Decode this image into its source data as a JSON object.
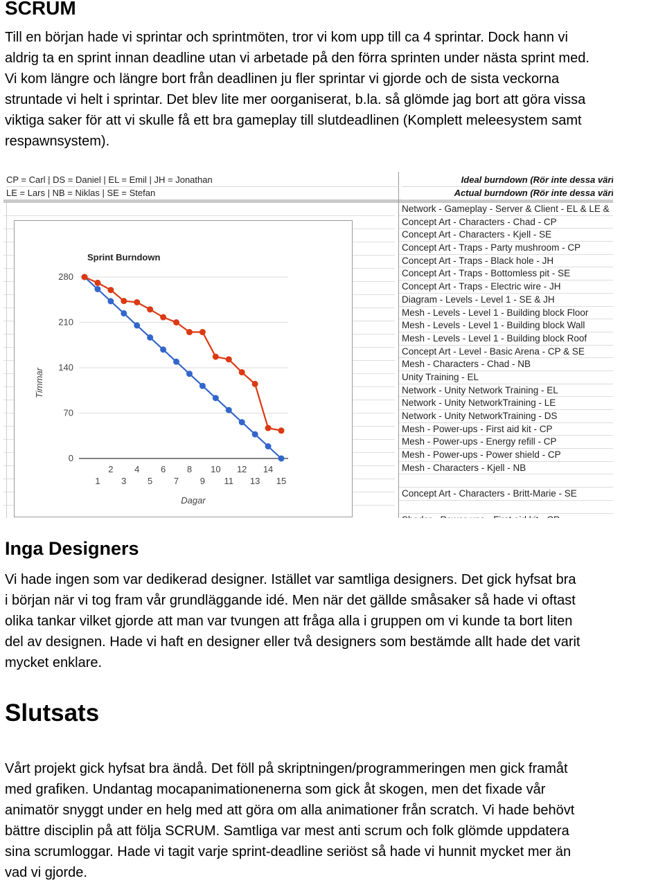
{
  "sections": {
    "scrum": {
      "heading": "SCRUM",
      "lines": [
        "Till en början hade vi sprintar och sprintmöten, tror vi kom upp till ca 4 sprintar. Dock hann vi",
        "aldrig ta en sprint innan deadline utan vi arbetade på den förra sprinten under nästa sprint med.",
        "Vi kom längre och längre bort från deadlinen ju fler sprintar vi gjorde och de sista veckorna",
        "struntade vi helt i sprintar. Det blev lite mer oorganiserat, b.la. så glömde jag bort att göra vissa",
        "viktiga saker för att vi skulle få ett bra gameplay till slutdeadlinen (Komplett meleesystem samt",
        "respawnsystem)."
      ]
    },
    "designers": {
      "heading": "Inga Designers",
      "lines": [
        "Vi hade ingen som var dedikerad designer. Istället var samtliga designers. Det gick hyfsat bra",
        "i början när vi tog fram vår grundläggande idé. Men när det gällde småsaker så hade vi oftast",
        "olika tankar vilket gjorde att man var tvungen att fråga alla i gruppen om vi kunde ta bort liten",
        "del av designen. Hade  vi haft en designer eller två designers som bestämde allt hade det varit",
        "mycket enklare."
      ]
    },
    "conclusion": {
      "heading": "Slutsats",
      "lines": [
        "Vårt projekt gick hyfsat bra ändå. Det föll på skriptningen/programmeringen men gick framåt",
        "med grafiken. Undantag mocapanimationenerna som gick åt skogen, men det fixade vår",
        "animatör snyggt under en helg med att göra om alla animationer från scratch.  Vi hade behövt",
        "bättre disciplin på att följa SCRUM. Samtliga var mest anti scrum och folk glömde uppdatera",
        "sina scrumloggar. Hade vi tagit varje sprint-deadline seriöst så hade vi hunnit mycket mer än",
        "vad vi gjorde."
      ]
    }
  },
  "spreadsheet": {
    "legend": [
      "CP = Carl | DS = Daniel | EL = Emil | JH = Jonathan",
      "LE = Lars | NB = Niklas | SE = Stefan"
    ],
    "headers": [
      "Ideal burndown (Rör inte dessa väri",
      "Actual burndown (Rör inte dessa väri"
    ],
    "tasks": [
      "Network - Gameplay - Server & Client - EL & LE &",
      "Concept Art - Characters - Chad - CP",
      "Concept Art - Characters - Kjell - SE",
      "Concept Art - Traps - Party mushroom - CP",
      "Concept Art - Traps - Black hole - JH",
      "Concept Art - Traps - Bottomless pit - SE",
      "Concept Art - Traps - Electric wire - JH",
      "Diagram - Levels - Level 1 - SE & JH",
      "Mesh - Levels - Level 1 - Building block Floor",
      "Mesh - Levels - Level 1 - Building block Wall",
      "Mesh - Levels - Level 1 - Building block Roof",
      "Concept Art - Level - Basic Arena - CP & SE",
      "Mesh - Characters - Chad - NB",
      "Unity Training - EL",
      "Network - Unity Network Training - EL",
      "Network - Unity NetworkTraining - LE",
      "Network - Unity NetworkTraining - DS",
      "Mesh - Power-ups - First aid kit - CP",
      "Mesh - Power-ups - Energy refill - CP",
      "Mesh - Power-ups - Power shield - CP",
      "Mesh - Characters - Kjell - NB",
      "",
      "Concept Art - Characters - Britt-Marie - SE",
      "",
      "Shader - Power-ups - First aid kit - CP"
    ]
  },
  "chart_data": {
    "type": "line",
    "title": "Sprint Burndown",
    "xlabel": "Dagar",
    "ylabel": "Timmar",
    "x": [
      0,
      1,
      2,
      3,
      4,
      5,
      6,
      7,
      8,
      9,
      10,
      11,
      12,
      13,
      14,
      15
    ],
    "xticks_upper": [
      "2",
      "4",
      "6",
      "8",
      "10",
      "12",
      "14"
    ],
    "xticks_lower": [
      "1",
      "3",
      "5",
      "7",
      "9",
      "11",
      "13",
      "15"
    ],
    "yticks": [
      0,
      70,
      140,
      210,
      280
    ],
    "ylim": [
      0,
      280
    ],
    "xlim": [
      0,
      15
    ],
    "grid": true,
    "legend": "none",
    "series": [
      {
        "name": "Ideal burndown",
        "color": "#3366cc",
        "values": [
          280,
          261.3,
          242.7,
          224,
          205.3,
          186.7,
          168,
          149.3,
          130.7,
          112,
          93.3,
          74.7,
          56,
          37.3,
          18.7,
          0
        ]
      },
      {
        "name": "Actual burndown",
        "color": "#dc3912",
        "values": [
          280,
          271,
          260,
          243,
          241,
          230,
          218,
          210,
          195,
          195,
          157,
          153,
          133,
          115,
          47,
          43
        ]
      }
    ]
  }
}
